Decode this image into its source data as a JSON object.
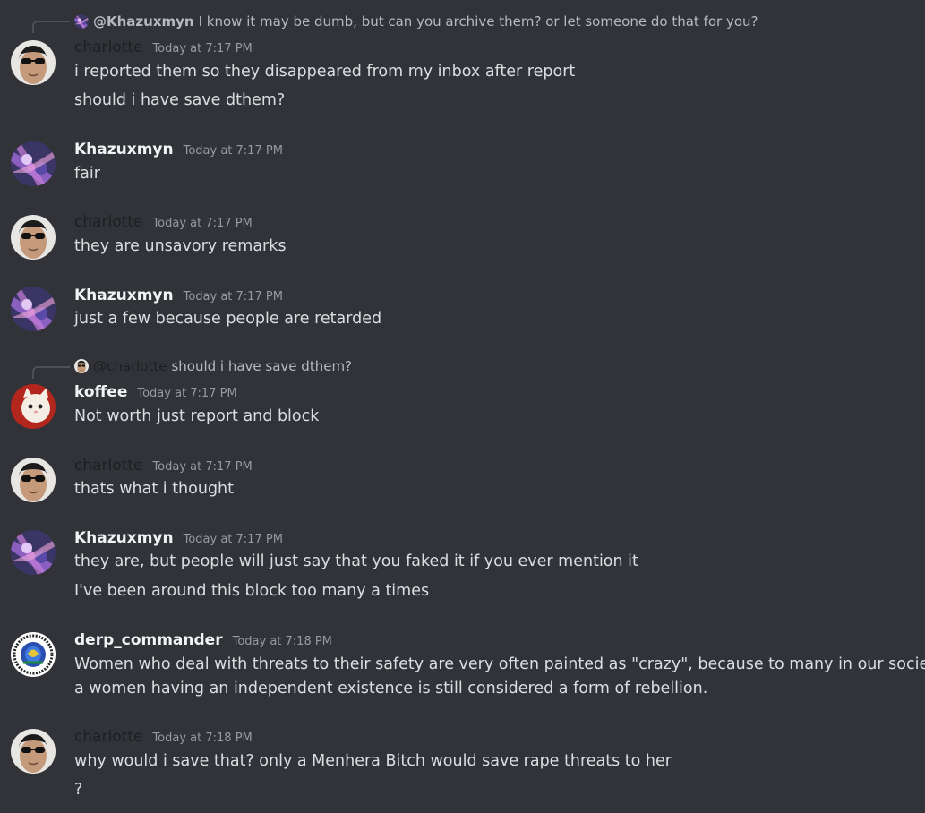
{
  "messages": [
    {
      "reply": {
        "name": "@Khazuxmyn",
        "text": "I know it may be dumb, but can you archive them? or let someone do that for you?"
      },
      "author": "charlotte",
      "time": "Today at 7:17 PM",
      "lines": [
        "i reported them so they disappeared from my inbox after report",
        "should i have save dthem?"
      ]
    },
    {
      "author": "Khazuxmyn",
      "time": "Today at 7:17 PM",
      "lines": [
        "fair"
      ]
    },
    {
      "author": "charlotte",
      "time": "Today at 7:17 PM",
      "lines": [
        "they are unsavory remarks"
      ]
    },
    {
      "author": "Khazuxmyn",
      "time": "Today at 7:17 PM",
      "lines": [
        "just a few because people are retarded"
      ]
    },
    {
      "reply": {
        "name": "@charlotte",
        "text": "should i have save dthem?"
      },
      "author": "koffee",
      "time": "Today at 7:17 PM",
      "lines": [
        "Not worth just report and block"
      ]
    },
    {
      "author": "charlotte",
      "time": "Today at 7:17 PM",
      "lines": [
        "thats what i thought"
      ]
    },
    {
      "author": "Khazuxmyn",
      "time": "Today at 7:17 PM",
      "lines": [
        "they are, but people will just say that you faked it if you ever mention it",
        "I've been around this block too many a times"
      ]
    },
    {
      "author": "derp_commander",
      "time": "Today at 7:18 PM",
      "lines": [
        "Women who deal with threats to their safety are very often painted as \"crazy\", because to many in our society,",
        "a women having an independent existence is still considered a form of rebellion."
      ]
    },
    {
      "author": "charlotte",
      "time": "Today at 7:18 PM",
      "lines": [
        "why would i save that? only a Menhera Bitch would save rape threats to her",
        "?"
      ]
    }
  ],
  "avatars": {
    "charlotte": "avatar-man-sunglasses",
    "Khazuxmyn": "avatar-purple-anime-art",
    "koffee": "avatar-white-kitten",
    "derp_commander": "avatar-blue-emblem-badge"
  },
  "colors": {
    "background": "#313338",
    "username": "#f2f3f5",
    "username_charlotte": "#1e1f22",
    "timestamp": "#949ba4",
    "text": "#dbdee1"
  }
}
